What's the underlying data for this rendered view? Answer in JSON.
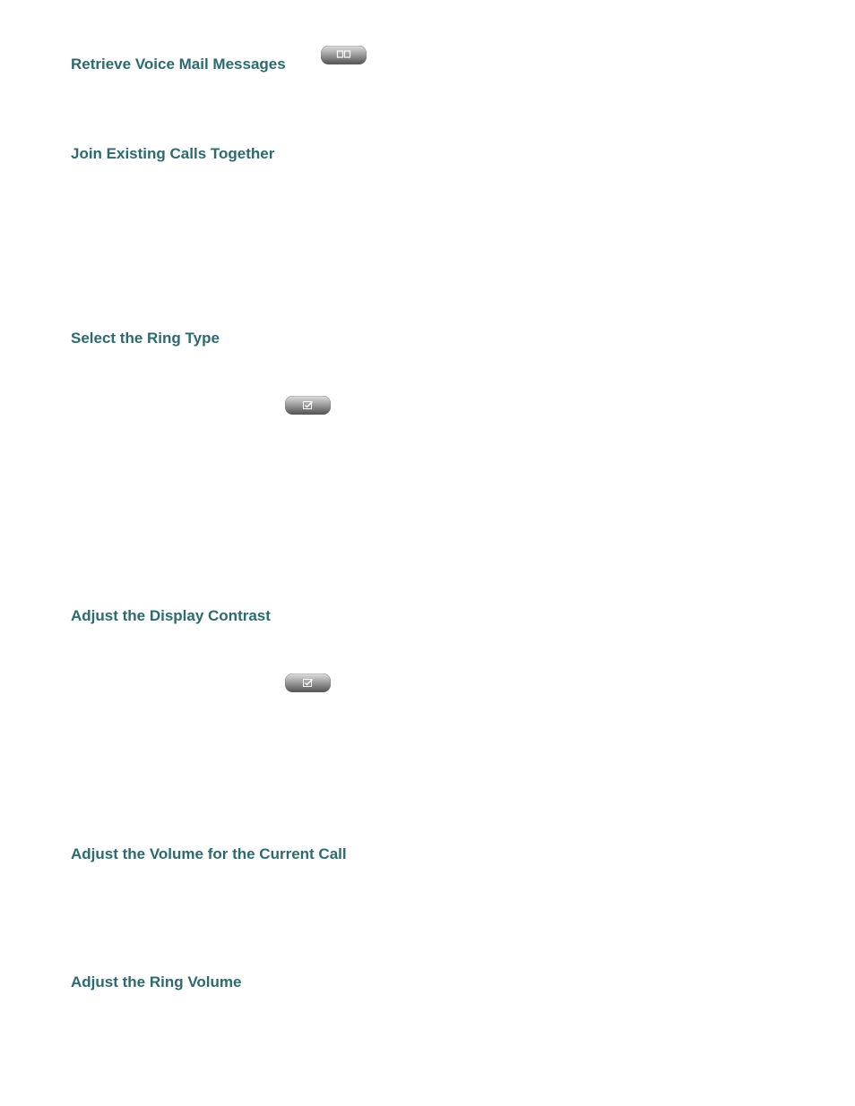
{
  "headings": {
    "retrieve_voicemail": "Retrieve Voice Mail Messages",
    "join_calls": "Join Existing Calls Together",
    "select_ring_type": "Select the Ring Type",
    "adjust_contrast": "Adjust the Display Contrast",
    "adjust_volume_call": "Adjust the Volume for the Current Call",
    "adjust_ring_volume": "Adjust the Ring Volume"
  },
  "icons": {
    "book": "book-icon",
    "check": "check-icon"
  }
}
